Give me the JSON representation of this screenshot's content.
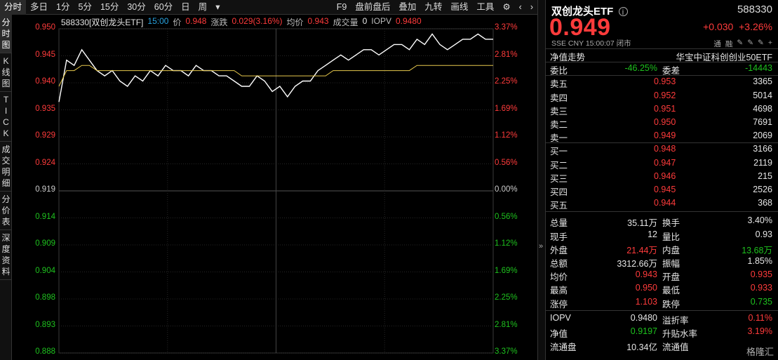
{
  "toolbar": {
    "items": [
      "分时",
      "多日",
      "1分",
      "5分",
      "15分",
      "30分",
      "60分",
      "日",
      "周",
      "▾"
    ],
    "right_items": [
      "F9",
      "盘前盘后",
      "叠加",
      "九转",
      "画线",
      "工具",
      "⚙",
      "‹",
      "›"
    ]
  },
  "vtabs": [
    "分\n时\n图",
    "K\n线\n图",
    "T\nI\nC\nK",
    "成\n交\n明\n细",
    "分\n价\n表",
    "深\n度\n资\n料"
  ],
  "chart_header": {
    "code_name": "588330[双创龙头ETF]",
    "time": "15:00",
    "price_label": "价",
    "price": "0.948",
    "change_label": "涨跌",
    "change": "0.029(3.16%)",
    "avg_label": "均价",
    "avg": "0.943",
    "vol_label": "成交量",
    "vol": "0",
    "iopv_label": "IOPV",
    "iopv": "0.9480"
  },
  "chart_data": {
    "type": "line",
    "prev_close": 0.919,
    "ylim": [
      0.888,
      0.95
    ],
    "y_ticks_left": [
      "0.950",
      "0.945",
      "0.940",
      "0.935",
      "0.929",
      "0.924",
      "0.919",
      "0.914",
      "0.909",
      "0.904",
      "0.898",
      "0.893",
      "0.888"
    ],
    "y_ticks_right": [
      "3.37%",
      "2.81%",
      "2.25%",
      "1.69%",
      "1.12%",
      "0.56%",
      "0.00%",
      "0.56%",
      "1.12%",
      "1.69%",
      "2.25%",
      "2.81%",
      "3.37%"
    ],
    "series": [
      {
        "name": "价",
        "color": "#ffffff",
        "values": [
          0.936,
          0.944,
          0.943,
          0.946,
          0.944,
          0.942,
          0.941,
          0.942,
          0.94,
          0.939,
          0.941,
          0.94,
          0.942,
          0.941,
          0.943,
          0.942,
          0.942,
          0.941,
          0.943,
          0.942,
          0.942,
          0.941,
          0.941,
          0.94,
          0.939,
          0.939,
          0.941,
          0.94,
          0.938,
          0.939,
          0.937,
          0.939,
          0.94,
          0.94,
          0.942,
          0.943,
          0.944,
          0.945,
          0.944,
          0.945,
          0.946,
          0.946,
          0.945,
          0.946,
          0.947,
          0.947,
          0.946,
          0.948,
          0.947,
          0.949,
          0.947,
          0.946,
          0.947,
          0.948,
          0.948,
          0.949,
          0.948,
          0.948
        ]
      },
      {
        "name": "均价",
        "color": "#e6c84c",
        "values": [
          0.939,
          0.942,
          0.942,
          0.943,
          0.943,
          0.942,
          0.942,
          0.942,
          0.942,
          0.942,
          0.942,
          0.942,
          0.942,
          0.942,
          0.942,
          0.942,
          0.942,
          0.942,
          0.942,
          0.942,
          0.942,
          0.942,
          0.942,
          0.942,
          0.941,
          0.941,
          0.941,
          0.941,
          0.941,
          0.941,
          0.941,
          0.941,
          0.941,
          0.941,
          0.941,
          0.941,
          0.942,
          0.942,
          0.942,
          0.942,
          0.942,
          0.942,
          0.942,
          0.942,
          0.942,
          0.942,
          0.942,
          0.943,
          0.943,
          0.943,
          0.943,
          0.943,
          0.943,
          0.943,
          0.943,
          0.943,
          0.943,
          0.943
        ]
      }
    ],
    "grid": true
  },
  "panel": {
    "title": "双创龙头ETF",
    "info_icon": "info-icon",
    "code": "588330",
    "price": "0.949",
    "change": "+0.030",
    "change_pct": "+3.26%",
    "sub": "SSE  CNY  15:00:07  闭市",
    "tags": [
      "通",
      "融",
      "✎",
      "✎",
      "✎",
      "+"
    ],
    "nav_label": "净值走势",
    "index_label": "华宝中证科创创业50ETF",
    "weibi_label": "委比",
    "weibi": "-46.25%",
    "weicha_label": "委差",
    "weicha": "-14443",
    "asks": [
      {
        "label": "卖五",
        "price": "0.953",
        "vol": "3365"
      },
      {
        "label": "卖四",
        "price": "0.952",
        "vol": "5014"
      },
      {
        "label": "卖三",
        "price": "0.951",
        "vol": "4698"
      },
      {
        "label": "卖二",
        "price": "0.950",
        "vol": "7691"
      },
      {
        "label": "卖一",
        "price": "0.949",
        "vol": "2069"
      }
    ],
    "bids": [
      {
        "label": "买一",
        "price": "0.948",
        "vol": "3166"
      },
      {
        "label": "买二",
        "price": "0.947",
        "vol": "2119"
      },
      {
        "label": "买三",
        "price": "0.946",
        "vol": "215"
      },
      {
        "label": "买四",
        "price": "0.945",
        "vol": "2526"
      },
      {
        "label": "买五",
        "price": "0.944",
        "vol": "368"
      }
    ],
    "stats": [
      {
        "l1": "总量",
        "v1": "35.11万",
        "c1": "white",
        "l2": "换手",
        "v2": "3.40%",
        "c2": "white"
      },
      {
        "l1": "现手",
        "v1": "12",
        "c1": "white",
        "l2": "量比",
        "v2": "0.93",
        "c2": "white"
      },
      {
        "l1": "外盘",
        "v1": "21.44万",
        "c1": "red",
        "l2": "内盘",
        "v2": "13.68万",
        "c2": "green"
      },
      {
        "l1": "总额",
        "v1": "3312.66万",
        "c1": "white",
        "l2": "振幅",
        "v2": "1.85%",
        "c2": "white"
      },
      {
        "l1": "均价",
        "v1": "0.943",
        "c1": "red",
        "l2": "开盘",
        "v2": "0.935",
        "c2": "red"
      },
      {
        "l1": "最高",
        "v1": "0.950",
        "c1": "red",
        "l2": "最低",
        "v2": "0.933",
        "c2": "red"
      },
      {
        "l1": "涨停",
        "v1": "1.103",
        "c1": "red",
        "l2": "跌停",
        "v2": "0.735",
        "c2": "green"
      }
    ],
    "stats2": [
      {
        "l1": "IOPV",
        "v1": "0.9480",
        "c1": "white",
        "l2": "溢折率",
        "v2": "0.11%",
        "c2": "red"
      },
      {
        "l1": "净值",
        "v1": "0.9197",
        "c1": "green",
        "l2": "升贴水率",
        "v2": "3.19%",
        "c2": "red"
      },
      {
        "l1": "流通盘",
        "v1": "10.34亿",
        "c1": "white",
        "l2": "流通值",
        "v2": "",
        "c2": "white"
      }
    ],
    "watermark": "格隆汇"
  }
}
